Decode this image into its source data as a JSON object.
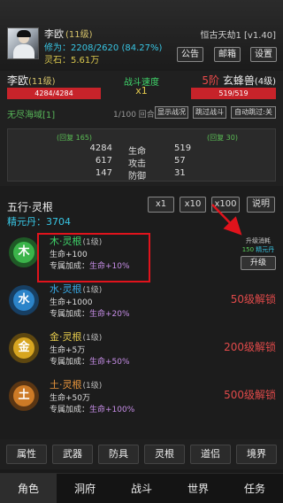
{
  "header": {
    "player_name": "李欧",
    "player_level": "(11级)",
    "cultivation": "修为：2208/2620 (84.27%)",
    "spirit_stone": "灵石：5.61万",
    "version": "恒古天劫1 [v1.40]",
    "buttons": {
      "notice": "公告",
      "mail": "邮箱",
      "settings": "设置"
    }
  },
  "battle": {
    "left_name": "李欧",
    "left_level": "(11级)",
    "left_hp": "4284/4284",
    "speed_label": "战斗速度",
    "speed_value": "x1",
    "right_tier": "5阶",
    "right_name": " 玄蜂兽",
    "right_level": "(4级)",
    "right_hp": "519/519",
    "zone": "无尽海域[1]",
    "round": "1/100 回合",
    "buttons": {
      "show_status": "显示战况",
      "skip": "跳过战斗",
      "auto_skip": "自动跳过:关"
    },
    "stats": {
      "left_regen": "(回复 165)",
      "right_regen": "(回复 30)",
      "rows": [
        {
          "left": "4284",
          "label": "生命",
          "right": "519"
        },
        {
          "left": "617",
          "label": "攻击",
          "right": "57"
        },
        {
          "left": "147",
          "label": "防御",
          "right": "31"
        }
      ]
    }
  },
  "wuxing": {
    "title": "五行·灵根",
    "yuan_dan": "精元丹：3704",
    "multipliers": [
      "x1",
      "x10",
      "x100"
    ],
    "help": "说明",
    "roots": [
      {
        "glyph": "木",
        "name": "木·灵根",
        "level": "(1级)",
        "life": "生命+100",
        "bonus_label": "专属加成：",
        "bonus": "生命+10%",
        "unlock": ""
      },
      {
        "glyph": "水",
        "name": "水·灵根",
        "level": "(1级)",
        "life": "生命+1000",
        "bonus_label": "专属加成：",
        "bonus": "生命+20%",
        "unlock": "50级解锁"
      },
      {
        "glyph": "金",
        "name": "金·灵根",
        "level": "(1级)",
        "life": "生命+5万",
        "bonus_label": "专属加成：",
        "bonus": "生命+50%",
        "unlock": "200级解锁"
      },
      {
        "glyph": "土",
        "name": "土·灵根",
        "level": "(1级)",
        "life": "生命+50万",
        "bonus_label": "专属加成：",
        "bonus": "生命+100%",
        "unlock": "500级解锁"
      }
    ],
    "upgrade": {
      "label": "升级消耗",
      "cost": "150",
      "cost_item": " 精元丹",
      "button": "升级"
    }
  },
  "sub_tabs": [
    "属性",
    "武器",
    "防具",
    "灵根",
    "道侣",
    "境界"
  ],
  "main_tabs": [
    "角色",
    "洞府",
    "战斗",
    "世界",
    "任务"
  ],
  "colors": {
    "accent_blue": "#38c6e4",
    "hp_red": "#c7232a",
    "unlock_red": "#e04a4a",
    "highlight_red": "#e0131c",
    "wood": "#3bb44a",
    "water": "#2c84c9",
    "metal": "#d7a520",
    "earth": "#cc7a26"
  }
}
